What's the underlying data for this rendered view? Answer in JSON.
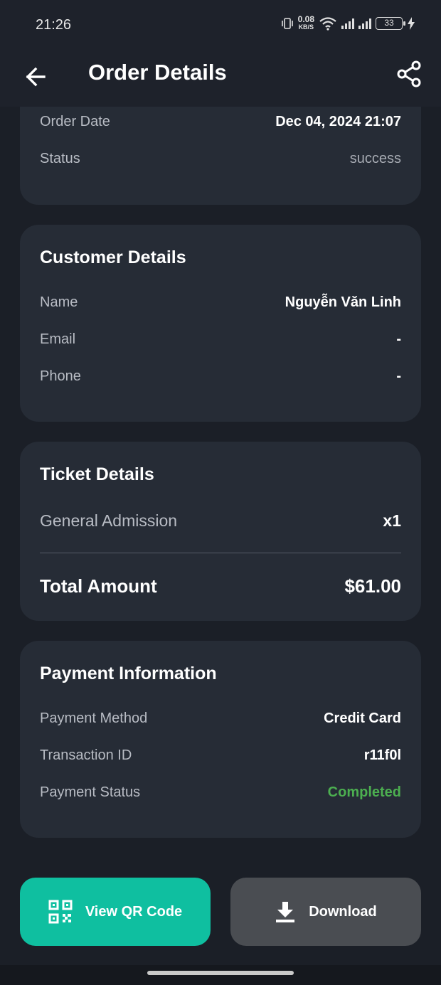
{
  "status_bar": {
    "time": "21:26",
    "net_speed": "0.08",
    "net_unit": "KB/S",
    "battery": "33"
  },
  "app_bar": {
    "title": "Order Details",
    "back_icon": "arrow-left-icon",
    "share_icon": "share-icon"
  },
  "order": {
    "date_label": "Order Date",
    "date_value": "Dec 04, 2024 21:07",
    "status_label": "Status",
    "status_value": "success"
  },
  "customer": {
    "title": "Customer Details",
    "name_label": "Name",
    "name_value": "Nguyễn Văn Linh",
    "email_label": "Email",
    "email_value": "-",
    "phone_label": "Phone",
    "phone_value": "-"
  },
  "tickets": {
    "title": "Ticket Details",
    "items": [
      {
        "name": "General Admission",
        "qty": "x1"
      }
    ],
    "total_label": "Total Amount",
    "total_value": "$61.00"
  },
  "payment": {
    "title": "Payment Information",
    "method_label": "Payment Method",
    "method_value": "Credit Card",
    "txn_label": "Transaction ID",
    "txn_value": "r11f0l",
    "status_label": "Payment Status",
    "status_value": "Completed"
  },
  "actions": {
    "qr_label": "View QR Code",
    "qr_icon": "qr-code-icon",
    "download_label": "Download",
    "download_icon": "download-icon"
  },
  "colors": {
    "accent": "#0fbfa0",
    "success": "#4caf50",
    "card": "#262c36",
    "background": "#1b1f27"
  }
}
